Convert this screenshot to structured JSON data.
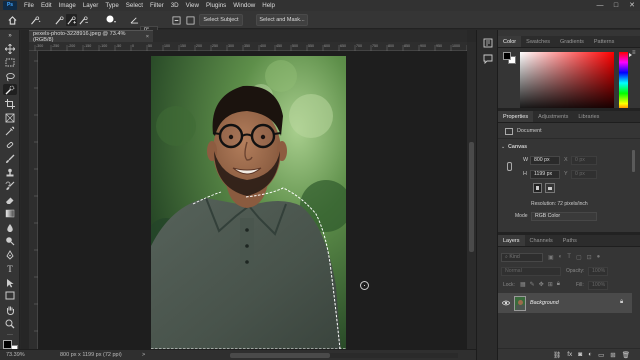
{
  "app": {
    "logo_text": "Ps"
  },
  "menu": [
    "File",
    "Edit",
    "Image",
    "Layer",
    "Type",
    "Select",
    "Filter",
    "3D",
    "View",
    "Plugins",
    "Window",
    "Help"
  ],
  "window_controls": {
    "minimize": "—",
    "maximize": "□",
    "close": "✕"
  },
  "options_bar": {
    "angle_value": "0°",
    "select_subject_label": "Select Subject",
    "select_mask_label": "Select and Mask..."
  },
  "document": {
    "tab_title": "pexels-photo-3228916.jpeg @ 73.4% (RGB/8)",
    "close_glyph": "×",
    "ruler_ticks": [
      "-300",
      "-250",
      "-200",
      "-150",
      "-100",
      "-50",
      "0",
      "50",
      "100",
      "150",
      "200",
      "250",
      "300",
      "350",
      "400",
      "450",
      "500",
      "550",
      "600",
      "650",
      "700",
      "750",
      "800",
      "850",
      "900",
      "950",
      "1000",
      "1050"
    ]
  },
  "status": {
    "zoom": "73.39%",
    "dimensions": "800 px x 1199 px (72 ppi)",
    "arrow": ">"
  },
  "panels": {
    "color_tabs": [
      "Color",
      "Swatches",
      "Gradients",
      "Patterns"
    ],
    "properties_tabs": [
      "Properties",
      "Adjustments",
      "Libraries"
    ],
    "document_label": "Document",
    "canvas_section": "Canvas",
    "w_label": "W",
    "w_value": "800 px",
    "x_label": "X",
    "x_value": "0 px",
    "h_label": "H",
    "h_value": "1199 px",
    "y_label": "Y",
    "y_value": "0 px",
    "resolution": "Resolution: 72 pixels/inch",
    "mode_label": "Mode",
    "mode_value": "RGB Color",
    "layers_tabs": [
      "Layers",
      "Channels",
      "Paths"
    ],
    "kind_placeholder": "Kind",
    "blend_mode": "Normal",
    "opacity_label": "Opacity:",
    "opacity_value": "100%",
    "lock_label": "Lock:",
    "fill_label": "Fill:",
    "fill_value": "100%",
    "layer_name": "Background"
  },
  "colors": {
    "accent": "#1473e6",
    "panel_bg": "#353535",
    "canvas_bg": "#1e1e1e",
    "selected_layer_bg": "#4a4a4a"
  }
}
